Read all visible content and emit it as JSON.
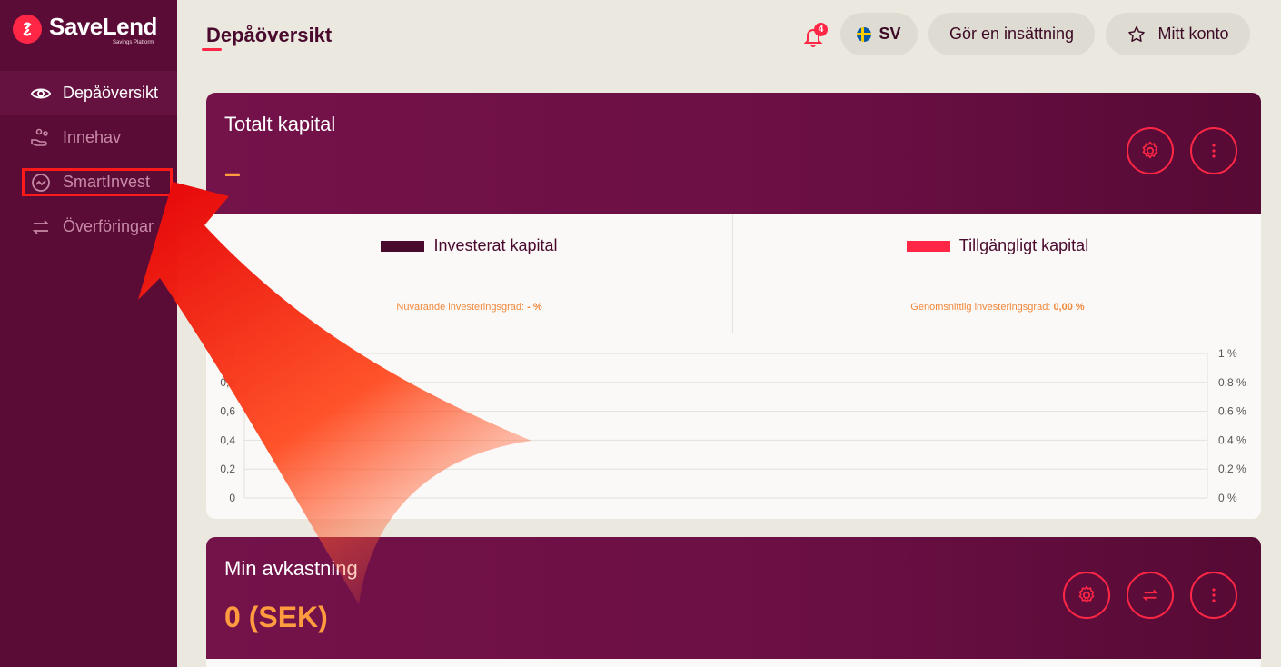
{
  "brand": {
    "name": "SaveLend",
    "tagline": "Savings Platform",
    "accent": "#ff2745"
  },
  "sidebar": {
    "items": [
      {
        "label": "Depåöversikt",
        "icon": "eye-icon",
        "active": true
      },
      {
        "label": "Innehav",
        "icon": "hand-coins-icon",
        "active": false
      },
      {
        "label": "SmartInvest",
        "icon": "trend-chart-icon",
        "active": false
      },
      {
        "label": "Överföringar",
        "icon": "transfer-arrows-icon",
        "active": false
      }
    ]
  },
  "header": {
    "title": "Depåöversikt",
    "notifications": {
      "count": "4",
      "icon": "bell-icon"
    },
    "language": "SV",
    "deposit_label": "Gör en insättning",
    "account_label": "Mitt konto",
    "account_icon": "star-icon"
  },
  "cards": {
    "total": {
      "title": "Totalt kapital",
      "value": "–",
      "legend_left": {
        "label": "Investerat kapital",
        "color": "#4a0a2e",
        "sub_label": "Nuvarande investeringsgrad:",
        "sub_value": "- %"
      },
      "legend_right": {
        "label": "Tillgängligt kapital",
        "color": "#ff2745",
        "sub_label": "Genomsnittlig investeringsgrad:",
        "sub_value": "0,00 %"
      }
    },
    "return": {
      "title": "Min avkastning",
      "value": "0 (SEK)"
    }
  },
  "chart_data": {
    "type": "line",
    "series": [],
    "y_left_ticks": [
      "0",
      "0,2",
      "0,4",
      "0,6",
      "0,8",
      "1"
    ],
    "y_right_ticks": [
      "0 %",
      "0.2 %",
      "0.4 %",
      "0.6 %",
      "0.8 %",
      "1 %"
    ],
    "ylim": [
      0,
      1
    ],
    "grid": true
  }
}
